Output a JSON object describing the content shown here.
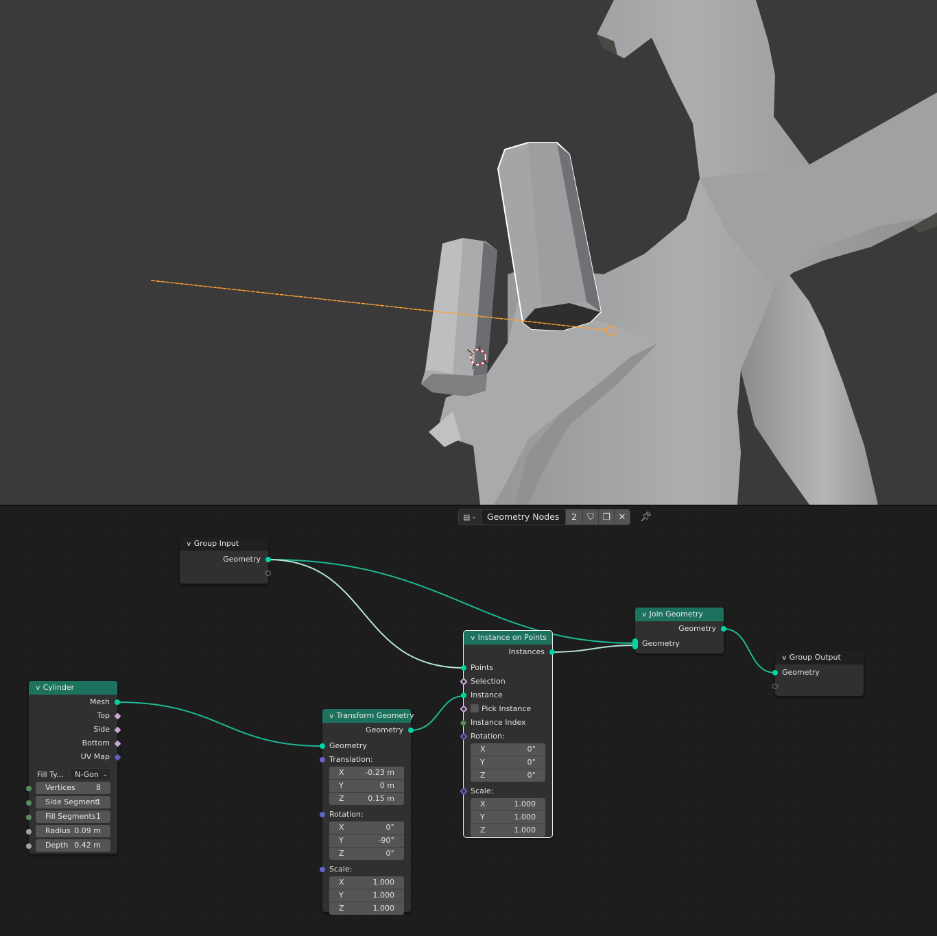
{
  "viewport": {
    "background": "#3a3a3a",
    "mesh_color": "#a4a6a8",
    "selection_outline": "#ffffff",
    "light_line_color": "#ffa133",
    "cursor_colors": [
      "#ffffff",
      "#d42a2a"
    ]
  },
  "header": {
    "datablock_type_icon": "node-tree-icon",
    "datablock_name": "Geometry Nodes",
    "user_count": "2",
    "fake_user_icon": "shield-icon",
    "duplicate_icon": "duplicate-icon",
    "unlink_icon": "close-icon",
    "pin_icon": "pin-icon"
  },
  "colors": {
    "geometry_socket": "#00d6a3",
    "vector_socket": "#6363c7",
    "int_socket": "#598c5c",
    "bool_socket": "#cca6d6",
    "float_socket": "#a1a1a1",
    "node_header_geometry": "#1d725e",
    "node_header_group": "#1f1f1f"
  },
  "nodes": {
    "group_input": {
      "title": "Group Input",
      "outputs": [
        "Geometry"
      ]
    },
    "cylinder": {
      "title": "Cylinder",
      "outputs": [
        "Mesh",
        "Top",
        "Side",
        "Bottom",
        "UV Map"
      ],
      "fill_type_label": "Fill Ty...",
      "fill_type_value": "N-Gon",
      "fields": [
        {
          "label": "Vertices",
          "value": "8"
        },
        {
          "label": "Side Segment",
          "value": "1"
        },
        {
          "label": "Fill Segments",
          "value": "1"
        },
        {
          "label": "Radius",
          "value": "0.09 m"
        },
        {
          "label": "Depth",
          "value": "0.42 m"
        }
      ]
    },
    "transform_geometry": {
      "title": "Transform Geometry",
      "output": "Geometry",
      "input_geometry": "Geometry",
      "translation_label": "Translation:",
      "translation": [
        {
          "axis": "X",
          "value": "-0.23 m"
        },
        {
          "axis": "Y",
          "value": "0 m"
        },
        {
          "axis": "Z",
          "value": "0.15 m"
        }
      ],
      "rotation_label": "Rotation:",
      "rotation": [
        {
          "axis": "X",
          "value": "0°"
        },
        {
          "axis": "Y",
          "value": "-90°"
        },
        {
          "axis": "Z",
          "value": "0°"
        }
      ],
      "scale_label": "Scale:",
      "scale": [
        {
          "axis": "X",
          "value": "1.000"
        },
        {
          "axis": "Y",
          "value": "1.000"
        },
        {
          "axis": "Z",
          "value": "1.000"
        }
      ]
    },
    "instance_on_points": {
      "title": "Instance on Points",
      "output": "Instances",
      "points": "Points",
      "selection": "Selection",
      "instance": "Instance",
      "pick_instance": "Pick Instance",
      "instance_index": "Instance Index",
      "rotation_label": "Rotation:",
      "rotation": [
        {
          "axis": "X",
          "value": "0°"
        },
        {
          "axis": "Y",
          "value": "0°"
        },
        {
          "axis": "Z",
          "value": "0°"
        }
      ],
      "scale_label": "Scale:",
      "scale": [
        {
          "axis": "X",
          "value": "1.000"
        },
        {
          "axis": "Y",
          "value": "1.000"
        },
        {
          "axis": "Z",
          "value": "1.000"
        }
      ]
    },
    "join_geometry": {
      "title": "Join Geometry",
      "output": "Geometry",
      "input": "Geometry"
    },
    "group_output": {
      "title": "Group Output",
      "input": "Geometry"
    }
  }
}
